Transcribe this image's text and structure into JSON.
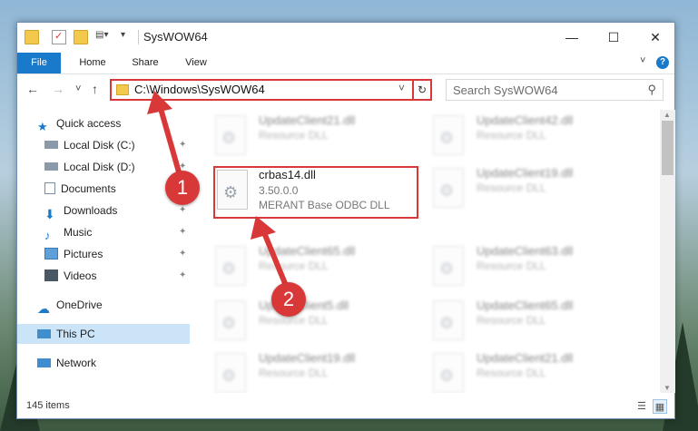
{
  "window": {
    "title": "SysWOW64",
    "controls": {
      "minimize": "—",
      "maximize": "☐",
      "close": "✕"
    }
  },
  "ribbon": {
    "tabs": [
      "File",
      "Home",
      "Share",
      "View"
    ],
    "collapse_icon": "˅",
    "help_icon": "?"
  },
  "navigation": {
    "back": "←",
    "forward": "→",
    "recent": "˅",
    "up": "↑",
    "address": "C:\\Windows\\SysWOW64",
    "address_dropdown": "˅",
    "refresh_icon": "↻",
    "search_placeholder": "Search SysWOW64",
    "search_icon": "⚲"
  },
  "sidebar": {
    "quick_access": "Quick access",
    "items": [
      {
        "label": "Local Disk (C:)",
        "icon": "drive-icon",
        "pinned": true
      },
      {
        "label": "Local Disk (D:)",
        "icon": "drive-icon",
        "pinned": true
      },
      {
        "label": "Documents",
        "icon": "documents-icon",
        "pinned": true
      },
      {
        "label": "Downloads",
        "icon": "downloads-icon",
        "pinned": true
      },
      {
        "label": "Music",
        "icon": "music-icon",
        "pinned": true
      },
      {
        "label": "Pictures",
        "icon": "pictures-icon",
        "pinned": true
      },
      {
        "label": "Videos",
        "icon": "videos-icon",
        "pinned": true
      }
    ],
    "onedrive": "OneDrive",
    "this_pc": "This PC",
    "network": "Network",
    "pin_glyph": "📌"
  },
  "files": {
    "left": [
      {
        "name": "UpdateClient21.dll",
        "type": "Resource DLL"
      },
      {
        "name": "crbas14.dll",
        "version": "3.50.0.0",
        "type": "MERANT Base ODBC DLL"
      },
      {
        "name": "UpdateClient65.dll",
        "type": "Resource DLL"
      },
      {
        "name": "UpdateClient5.dll",
        "type": "Resource DLL"
      },
      {
        "name": "UpdateClient19.dll",
        "type": "Resource DLL"
      }
    ],
    "right": [
      {
        "name": "UpdateClient42.dll",
        "type": "Resource DLL"
      },
      {
        "name": "UpdateClient19.dll",
        "type": "Resource DLL"
      },
      {
        "name": "UpdateClient63.dll",
        "type": "Resource DLL"
      },
      {
        "name": "UpdateClient65.dll",
        "type": "Resource DLL"
      },
      {
        "name": "UpdateClient21.dll",
        "type": "Resource DLL"
      }
    ]
  },
  "status": {
    "item_count": "145 items"
  },
  "annotations": {
    "step1": "1",
    "step2": "2"
  },
  "colors": {
    "accent": "#1979ca",
    "highlight": "#d93838",
    "selection": "#cce4f7"
  }
}
